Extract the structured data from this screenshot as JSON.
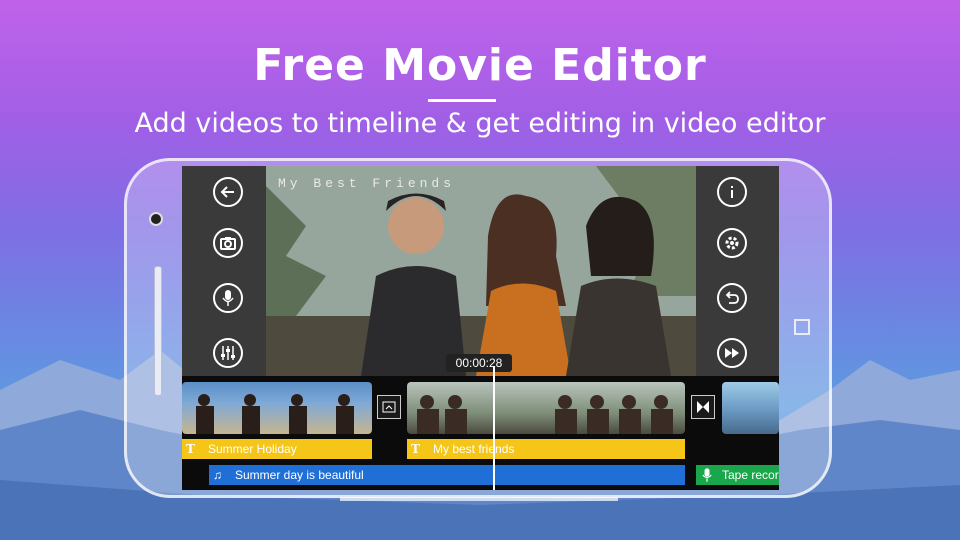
{
  "header": {
    "title": "Free Movie Editor",
    "subtitle": "Add videos to timeline & get editing in video editor"
  },
  "preview": {
    "watermark_text": "My Best Friends",
    "current_time": "00:00:28"
  },
  "left_controls": [
    "back-arrow-icon",
    "camera-icon",
    "microphone-icon",
    "equalizer-icon"
  ],
  "right_controls": [
    "info-icon",
    "settings-gear-icon",
    "undo-icon",
    "fast-forward-icon"
  ],
  "timeline": {
    "text_tracks": [
      {
        "label": "Summer Holiday",
        "color": "#f5c518"
      },
      {
        "label": "My best friends",
        "color": "#f5c518"
      }
    ],
    "music_track": {
      "label": "Summer day is beautiful",
      "color": "#1f6fd6"
    },
    "voice_track": {
      "label": "Tape recor",
      "color": "#1aa64a"
    },
    "text_marker": "T"
  },
  "colors": {
    "accent_yellow": "#f5c518",
    "music_blue": "#1f6fd6",
    "voice_green": "#1aa64a"
  }
}
